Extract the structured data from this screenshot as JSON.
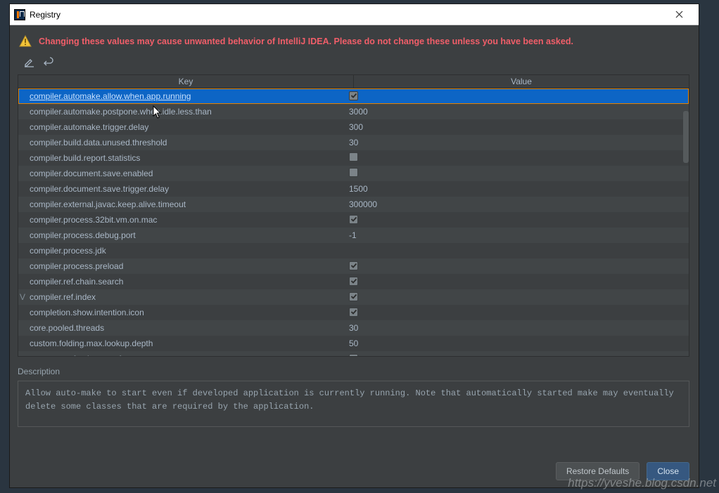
{
  "window": {
    "title": "Registry"
  },
  "warning": "Changing these values may cause unwanted behavior of IntelliJ IDEA. Please do not change these unless you have been asked.",
  "columns": {
    "key": "Key",
    "value": "Value"
  },
  "rows": [
    {
      "key": "compiler.automake.allow.when.app.running",
      "type": "check",
      "checked": true,
      "selected": true,
      "marker": ""
    },
    {
      "key": "compiler.automake.postpone.when.idle.less.than",
      "type": "text",
      "value": "3000",
      "marker": ""
    },
    {
      "key": "compiler.automake.trigger.delay",
      "type": "text",
      "value": "300",
      "marker": ""
    },
    {
      "key": "compiler.build.data.unused.threshold",
      "type": "text",
      "value": "30",
      "marker": ""
    },
    {
      "key": "compiler.build.report.statistics",
      "type": "check",
      "checked": false,
      "marker": ""
    },
    {
      "key": "compiler.document.save.enabled",
      "type": "check",
      "checked": false,
      "marker": ""
    },
    {
      "key": "compiler.document.save.trigger.delay",
      "type": "text",
      "value": "1500",
      "marker": ""
    },
    {
      "key": "compiler.external.javac.keep.alive.timeout",
      "type": "text",
      "value": "300000",
      "marker": ""
    },
    {
      "key": "compiler.process.32bit.vm.on.mac",
      "type": "check",
      "checked": true,
      "marker": ""
    },
    {
      "key": "compiler.process.debug.port",
      "type": "text",
      "value": "-1",
      "marker": ""
    },
    {
      "key": "compiler.process.jdk",
      "type": "text",
      "value": "",
      "marker": ""
    },
    {
      "key": "compiler.process.preload",
      "type": "check",
      "checked": true,
      "marker": ""
    },
    {
      "key": "compiler.ref.chain.search",
      "type": "check",
      "checked": true,
      "marker": ""
    },
    {
      "key": "compiler.ref.index",
      "type": "check",
      "checked": true,
      "marker": "V"
    },
    {
      "key": "completion.show.intention.icon",
      "type": "check",
      "checked": true,
      "marker": ""
    },
    {
      "key": "core.pooled.threads",
      "type": "text",
      "value": "30",
      "marker": ""
    },
    {
      "key": "custom.folding.max.lookup.depth",
      "type": "text",
      "value": "50",
      "marker": ""
    },
    {
      "key": "cvs.roots.refresh.uses.vfs",
      "type": "check",
      "checked": true,
      "marker": ""
    }
  ],
  "description": {
    "label": "Description",
    "text": "Allow auto-make to start even if developed application is currently running. Note that automatically started make may eventually delete some classes that are required by the application."
  },
  "buttons": {
    "restore": "Restore Defaults",
    "close": "Close"
  },
  "watermark": "https://yveshe.blog.csdn.net"
}
